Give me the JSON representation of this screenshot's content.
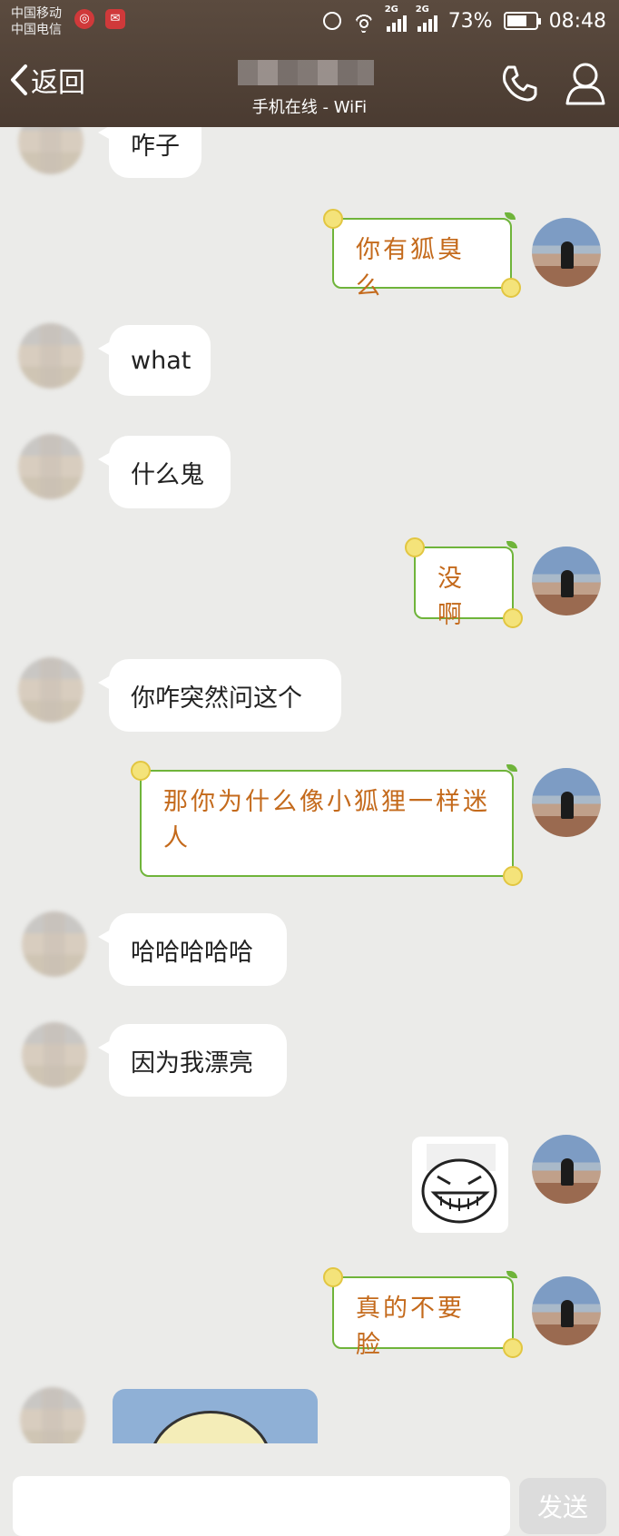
{
  "status_bar": {
    "carrier_1": "中国移动",
    "carrier_2": "中国电信",
    "network_1": "2G",
    "network_2": "2G",
    "battery": "73%",
    "time": "08:48"
  },
  "nav": {
    "back_label": "返回",
    "subtitle": "手机在线 - WiFi"
  },
  "messages": [
    {
      "side": "left",
      "text": "咋子"
    },
    {
      "side": "right",
      "text": "你有狐臭么"
    },
    {
      "side": "left",
      "text": "what"
    },
    {
      "side": "left",
      "text": "什么鬼"
    },
    {
      "side": "right",
      "text": "没啊"
    },
    {
      "side": "left",
      "text": "你咋突然问这个"
    },
    {
      "side": "right",
      "text": "那你为什么像小狐狸一样迷人"
    },
    {
      "side": "left",
      "text": "哈哈哈哈哈"
    },
    {
      "side": "left",
      "text": "因为我漂亮"
    },
    {
      "side": "right",
      "text": "",
      "type": "sticker"
    },
    {
      "side": "right",
      "text": "真的不要脸"
    },
    {
      "side": "left",
      "text": "",
      "type": "image"
    }
  ],
  "input": {
    "send_label": "发送"
  },
  "colors": {
    "header_bg": "#4f4036",
    "chat_bg": "#ebebe9",
    "bubble_border": "#6fb43a",
    "bubble_text": "#c46a1c"
  }
}
